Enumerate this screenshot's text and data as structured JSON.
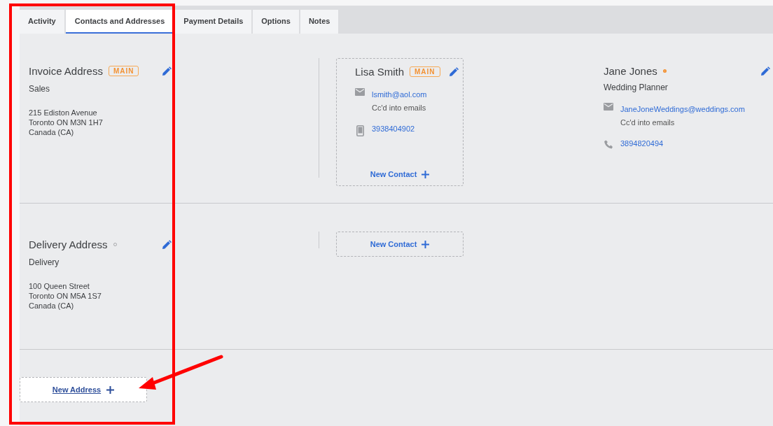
{
  "tabs": [
    {
      "label": "Activity",
      "selected": false
    },
    {
      "label": "Contacts and Addresses",
      "selected": true
    },
    {
      "label": "Payment Details",
      "selected": false
    },
    {
      "label": "Options",
      "selected": false
    },
    {
      "label": "Notes",
      "selected": false
    }
  ],
  "addresses": [
    {
      "title": "Invoice Address",
      "main": true,
      "badge": "MAIN",
      "type": "Sales",
      "lines": [
        "215 Ediston Avenue",
        "Toronto ON M3N 1H7",
        "Canada (CA)"
      ],
      "new_contact": "New Contact",
      "contacts": [
        {
          "name": "Lisa Smith",
          "main": true,
          "badge": "MAIN",
          "email": "lsmith@aol.com",
          "email_note": "Cc'd into emails",
          "phone": {
            "kind": "mobile",
            "number": "3938404902"
          }
        },
        {
          "name": "Jane Jones",
          "main": false,
          "role": "Wedding Planner",
          "email": "JaneJoneWeddings@weddings.com",
          "email_note": "Cc'd into emails",
          "phone": {
            "kind": "landline",
            "number": "3894820494"
          }
        }
      ]
    },
    {
      "title": "Delivery Address",
      "main": false,
      "type": "Delivery",
      "lines": [
        "100 Queen Street",
        "Toronto ON M5A 1S7",
        "Canada (CA)"
      ],
      "new_contact": "New Contact"
    }
  ],
  "new_address": "New Address"
}
